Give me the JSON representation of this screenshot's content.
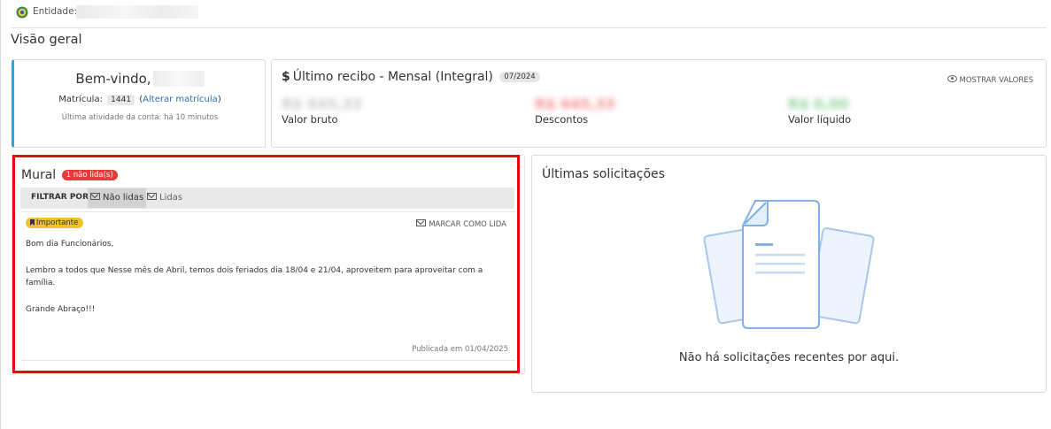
{
  "topbar": {
    "entity_label": "Entidade:"
  },
  "page_title": "Visão geral",
  "welcome": {
    "greeting": "Bem-vindo,",
    "matricula_label": "Matrícula:",
    "matricula_value": "1441",
    "change_link": "Alterar matrícula",
    "last_activity": "Última atividade da conta: há 10 minutos"
  },
  "recibo": {
    "dollar_icon": "$",
    "title": "Último recibo - Mensal (Integral)",
    "period": "07/2024",
    "show_values": "MOSTRAR VALORES",
    "values": [
      {
        "amount": "R$ 645,33",
        "label": "Valor bruto",
        "color": "#c8c8c8"
      },
      {
        "amount": "R$ 645,33",
        "label": "Descontos",
        "color": "#f28b8b"
      },
      {
        "amount": "R$ 0,00",
        "label": "Valor líquido",
        "color": "#8fd39a"
      }
    ]
  },
  "mural": {
    "title": "Mural",
    "unread_badge": "1 não lida(s)",
    "filter_label": "FILTRAR POR",
    "filter_unread": "Não lidas",
    "filter_read": "Lidas",
    "tag": "Importante",
    "mark_read": "MARCAR COMO LIDA",
    "body": [
      "Bom dia Funcionários,",
      "Lembro a todos que Nesse mês de Abril, temos dois feriados dia 18/04 e 21/04, aproveitem para aproveitar com a família.",
      "Grande Abraço!!!"
    ],
    "published": "Publicada em 01/04/2025"
  },
  "solicitacoes": {
    "title": "Últimas solicitações",
    "empty_message": "Não há solicitações recentes por aqui."
  },
  "colors": {
    "accent": "#3aa0d9",
    "danger": "#e53a3a",
    "important": "#f0c033",
    "link": "#2a6fb3",
    "highlight": "#e01010"
  }
}
